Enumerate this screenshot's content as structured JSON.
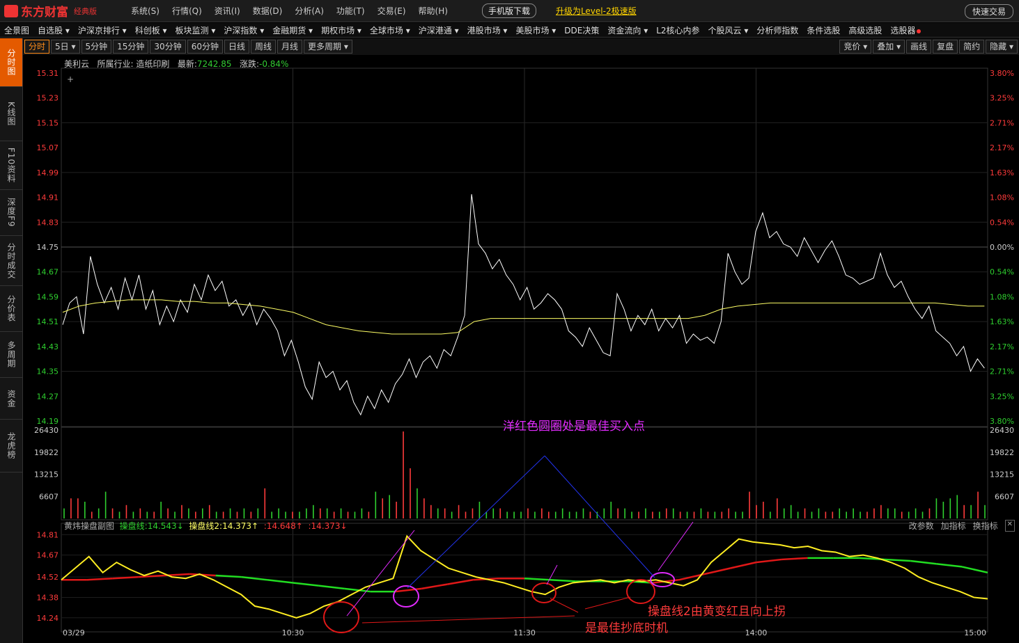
{
  "app": {
    "logo": "东方财富",
    "edition": "经典版",
    "mobile_download": "手机版下载",
    "upgrade": "升级为Level-2极速版",
    "quick_trade": "快速交易"
  },
  "sysmenu": [
    "系统(S)",
    "行情(Q)",
    "资讯(I)",
    "数据(D)",
    "分析(A)",
    "功能(T)",
    "交易(E)",
    "帮助(H)"
  ],
  "nav": [
    "全景图",
    "自选股 ▾",
    "沪深京排行 ▾",
    "科创板 ▾",
    "板块监测 ▾",
    "沪深指数 ▾",
    "金融期货 ▾",
    "期权市场 ▾",
    "全球市场 ▾",
    "沪深港通 ▾",
    "港股市场 ▾",
    "美股市场 ▾",
    "DDE决策",
    "资金流向 ▾",
    "L2核心内参",
    "个股风云 ▾",
    "分析师指数",
    "条件选股",
    "高级选股",
    "选股器"
  ],
  "sidebar": [
    "分时图",
    "K线图",
    "F10资料",
    "深度F9",
    "分时成交",
    "分价表",
    "多周期",
    "资金",
    "龙虎榜"
  ],
  "periods": [
    "分时",
    "5日 ▾",
    "5分钟",
    "15分钟",
    "30分钟",
    "60分钟",
    "日线",
    "周线",
    "月线",
    "更多周期 ▾"
  ],
  "right_tools": [
    "竞价 ▾",
    "叠加 ▾",
    "画线",
    "复盘",
    "简约",
    "隐藏 ▾"
  ],
  "stock": {
    "name": "美利云",
    "industry_label": "所属行业:",
    "industry": "造纸印刷",
    "latest_label": "最新:",
    "latest": "7242.85",
    "change_label": "涨跌:",
    "change": "-0.84%"
  },
  "indicator": {
    "name": "黄炜操盘副图",
    "l1": "操盘线:14.543↓",
    "l2": "操盘线2:14.373↑",
    "v3": ":14.648↑",
    "v4": ":14.373↓",
    "tools": [
      "改参数",
      "加指标",
      "换指标"
    ]
  },
  "annotations": {
    "top": "洋红色圆圈处是最佳买入点",
    "right": "操盘线2由黄变红且向上拐",
    "bottom": "是最佳抄底时机"
  },
  "colors": {
    "up": "#ff3b3b",
    "down": "#2fd02f",
    "avg": "#ffff66",
    "magenta": "#e22bff",
    "price": "#ffffff"
  },
  "chart_data": {
    "type": "line",
    "price_axis": {
      "ticks": [
        "15.31",
        "15.23",
        "15.15",
        "15.07",
        "14.99",
        "14.91",
        "14.83",
        "14.75",
        "14.67",
        "14.59",
        "14.51",
        "14.43",
        "14.35",
        "14.27",
        "14.19"
      ],
      "pct": [
        "3.80%",
        "3.25%",
        "2.71%",
        "2.17%",
        "1.63%",
        "1.08%",
        "0.54%",
        "0.00%",
        "0.54%",
        "1.08%",
        "1.63%",
        "2.17%",
        "2.71%",
        "3.25%",
        "3.80%"
      ],
      "ylim": [
        14.19,
        15.31
      ],
      "ref": 14.75
    },
    "vol_axis": {
      "ticks": [
        "26430",
        "19822",
        "13215",
        "6607"
      ],
      "max": 26430
    },
    "ind_axis": {
      "ticks": [
        "14.81",
        "14.67",
        "14.52",
        "14.38",
        "14.24"
      ],
      "ylim": [
        14.22,
        14.84
      ]
    },
    "x_labels": [
      "03/29",
      "10:30",
      "11:30",
      "14:00",
      "15:00"
    ],
    "price": [
      14.5,
      14.57,
      14.59,
      14.47,
      14.72,
      14.63,
      14.57,
      14.62,
      14.55,
      14.65,
      14.58,
      14.66,
      14.55,
      14.61,
      14.5,
      14.56,
      14.51,
      14.58,
      14.54,
      14.63,
      14.58,
      14.66,
      14.61,
      14.64,
      14.56,
      14.58,
      14.53,
      14.57,
      14.5,
      14.55,
      14.52,
      14.48,
      14.4,
      14.45,
      14.38,
      14.3,
      14.26,
      14.38,
      14.33,
      14.35,
      14.29,
      14.32,
      14.25,
      14.21,
      14.27,
      14.23,
      14.29,
      14.25,
      14.31,
      14.34,
      14.39,
      14.33,
      14.38,
      14.4,
      14.36,
      14.42,
      14.4,
      14.46,
      14.53,
      14.92,
      14.76,
      14.73,
      14.68,
      14.71,
      14.66,
      14.63,
      14.58,
      14.62,
      14.55,
      14.57,
      14.6,
      14.58,
      14.55,
      14.48,
      14.46,
      14.43,
      14.49,
      14.45,
      14.41,
      14.4,
      14.6,
      14.55,
      14.48,
      14.53,
      14.5,
      14.55,
      14.48,
      14.52,
      14.49,
      14.53,
      14.44,
      14.47,
      14.45,
      14.46,
      14.44,
      14.51,
      14.73,
      14.67,
      14.63,
      14.65,
      14.8,
      14.86,
      14.78,
      14.8,
      14.76,
      14.75,
      14.72,
      14.78,
      14.74,
      14.7,
      14.74,
      14.77,
      14.72,
      14.66,
      14.65,
      14.63,
      14.64,
      14.65,
      14.73,
      14.66,
      14.62,
      14.64,
      14.59,
      14.55,
      14.52,
      14.56,
      14.48,
      14.46,
      14.44,
      14.4,
      14.43,
      14.35,
      14.39,
      14.36
    ],
    "avg": [
      14.54,
      14.56,
      14.57,
      14.575,
      14.58,
      14.58,
      14.58,
      14.575,
      14.575,
      14.57,
      14.57,
      14.565,
      14.56,
      14.55,
      14.54,
      14.52,
      14.5,
      14.49,
      14.48,
      14.475,
      14.47,
      14.47,
      14.47,
      14.47,
      14.475,
      14.51,
      14.52,
      14.52,
      14.52,
      14.52,
      14.52,
      14.52,
      14.52,
      14.52,
      14.52,
      14.52,
      14.52,
      14.52,
      14.52,
      14.53,
      14.55,
      14.56,
      14.565,
      14.57,
      14.57,
      14.57,
      14.57,
      14.57,
      14.57,
      14.57,
      14.57,
      14.57,
      14.57,
      14.57,
      14.565,
      14.56,
      14.56
    ],
    "ind_yellow": [
      14.5,
      14.58,
      14.66,
      14.55,
      14.62,
      14.57,
      14.53,
      14.56,
      14.52,
      14.51,
      14.54,
      14.5,
      14.45,
      14.4,
      14.32,
      14.3,
      14.27,
      14.24,
      14.27,
      14.32,
      14.35,
      14.4,
      14.45,
      14.48,
      14.51,
      14.8,
      14.7,
      14.64,
      14.58,
      14.55,
      14.52,
      14.5,
      14.48,
      14.45,
      14.42,
      14.4,
      14.45,
      14.48,
      14.49,
      14.5,
      14.48,
      14.5,
      14.49,
      14.5,
      14.48,
      14.46,
      14.5,
      14.62,
      14.7,
      14.78,
      14.76,
      14.75,
      14.74,
      14.72,
      14.73,
      14.7,
      14.69,
      14.66,
      14.67,
      14.65,
      14.62,
      14.58,
      14.52,
      14.48,
      14.45,
      14.42,
      14.38,
      14.37
    ],
    "ind_trend": [
      14.5,
      14.5,
      14.51,
      14.52,
      14.53,
      14.54,
      14.53,
      14.52,
      14.5,
      14.48,
      14.46,
      14.44,
      14.42,
      14.42,
      14.44,
      14.47,
      14.5,
      14.51,
      14.51,
      14.5,
      14.49,
      14.49,
      14.49,
      14.48,
      14.5,
      14.54,
      14.58,
      14.62,
      14.64,
      14.65,
      14.65,
      14.65,
      14.64,
      14.63,
      14.61,
      14.59,
      14.55
    ],
    "ind_trend_colors": [
      "red",
      "red",
      "red",
      "red",
      "red",
      "red",
      "green",
      "green",
      "green",
      "green",
      "green",
      "green",
      "green",
      "red",
      "red",
      "red",
      "red",
      "red",
      "green",
      "green",
      "green",
      "green",
      "green",
      "red",
      "red",
      "red",
      "red",
      "red",
      "red",
      "green",
      "green",
      "green",
      "green",
      "green",
      "green",
      "green"
    ],
    "volume": [
      3,
      6,
      6,
      5,
      2,
      3,
      8,
      3,
      2,
      4,
      2,
      3,
      2,
      2,
      5,
      3,
      2,
      4,
      3,
      2,
      3,
      4,
      2,
      2,
      3,
      2,
      3,
      2,
      3,
      9,
      2,
      3,
      2,
      2,
      2,
      3,
      4,
      3,
      3,
      2,
      3,
      2,
      2,
      3,
      2,
      8,
      6,
      7,
      5,
      26,
      15,
      9,
      6,
      4,
      3,
      3,
      2,
      4,
      2,
      3,
      5,
      2,
      3,
      3,
      2,
      2,
      2,
      3,
      2,
      3,
      2,
      2,
      3,
      2,
      2,
      3,
      2,
      2,
      3,
      5,
      3,
      3,
      2,
      2,
      3,
      2,
      2,
      3,
      3,
      2,
      2,
      2,
      3,
      2,
      2,
      2,
      3,
      2,
      2,
      8,
      4,
      5,
      2,
      6,
      3,
      4,
      2,
      3,
      2,
      3,
      2,
      2,
      3,
      2,
      3,
      2,
      2,
      3,
      4,
      3,
      3,
      2,
      2,
      3,
      2,
      3,
      6,
      5,
      6,
      7,
      4,
      4,
      8,
      4
    ]
  }
}
